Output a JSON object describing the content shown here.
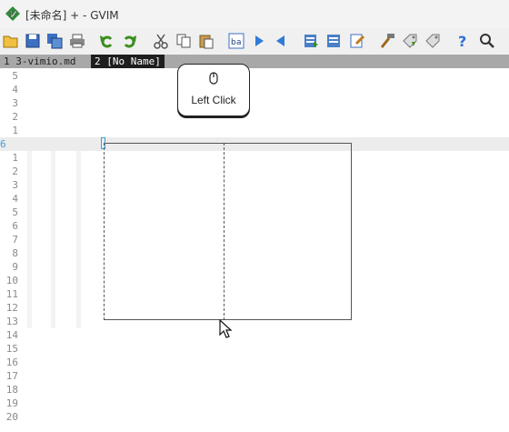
{
  "window": {
    "title": "[未命名] + - GVIM"
  },
  "toolbar": {
    "buttons": [
      "open-icon",
      "save-icon",
      "save-all-icon",
      "print-icon",
      "undo-icon",
      "redo-icon",
      "cut-icon",
      "copy-icon",
      "paste-icon",
      "find-replace-icon",
      "find-next-icon",
      "find-prev-icon",
      "load-session-icon",
      "save-session-icon",
      "run-script-icon",
      "make-icon",
      "build-tags-icon",
      "jump-tag-icon",
      "help-icon",
      "find-help-icon"
    ]
  },
  "tabs": [
    {
      "label": "1 3-vimio.md"
    },
    {
      "label": "2 [No Name]"
    }
  ],
  "gutter": {
    "above": [
      "5",
      "4",
      "3",
      "2",
      "1"
    ],
    "current": "6",
    "below": [
      "1",
      "2",
      "3",
      "4",
      "5",
      "6",
      "7",
      "8",
      "9",
      "10",
      "11",
      "12",
      "13",
      "14",
      "15",
      "16",
      "17",
      "18",
      "19",
      "20"
    ]
  },
  "overlay": {
    "label": "Left Click"
  }
}
